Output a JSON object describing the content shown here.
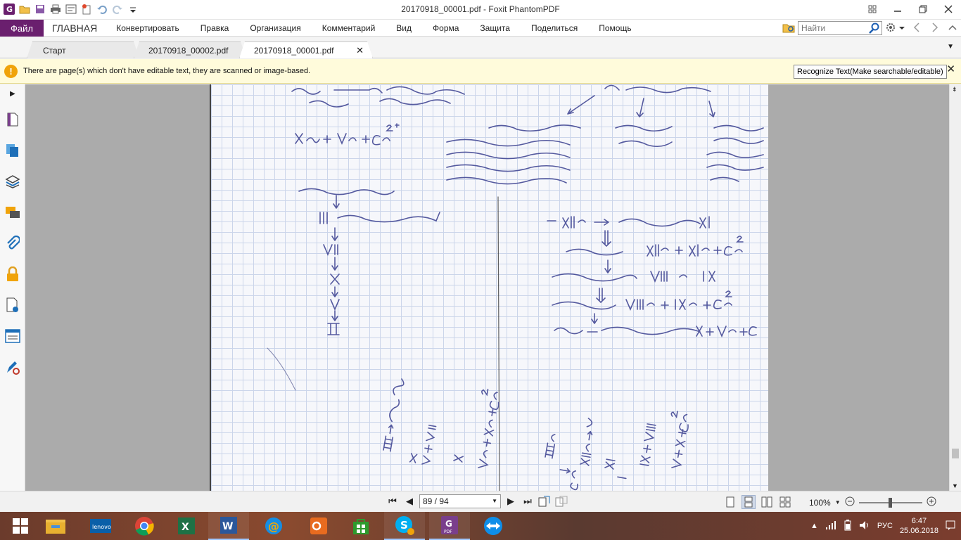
{
  "window": {
    "title": "20170918_00001.pdf - Foxit PhantomPDF"
  },
  "menu": {
    "file": "Файл",
    "items": [
      "ГЛАВНАЯ",
      "Конвертировать",
      "Правка",
      "Организация",
      "Комментарий",
      "Вид",
      "Форма",
      "Защита",
      "Поделиться",
      "Помощь"
    ],
    "search_placeholder": "Найти"
  },
  "tabs": [
    {
      "label": "Старт"
    },
    {
      "label": "20170918_00002.pdf"
    },
    {
      "label": "20170918_00001.pdf"
    }
  ],
  "notification": {
    "text": "There are page(s) which don't have editable text, they are scanned or image-based.",
    "button": "Recognize Text(Make searchable/editable)"
  },
  "status": {
    "page": "89 / 94",
    "zoom": "100%"
  },
  "tray": {
    "lang": "РУС",
    "time": "6:47",
    "date": "25.06.2018"
  },
  "colors": {
    "file_tab": "#6a1f6e",
    "notify_bg": "#fffbdb",
    "warning": "#f0a30a",
    "ink": "#3a3f8f"
  }
}
